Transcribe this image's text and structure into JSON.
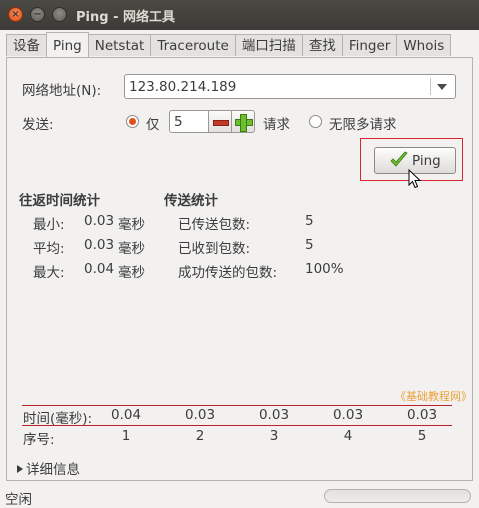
{
  "window": {
    "title": "Ping - 网络工具",
    "close_icon": "×",
    "minimize_icon": "−",
    "maximize_icon": ""
  },
  "tabs": [
    {
      "label": "设备",
      "active": false
    },
    {
      "label": "Ping",
      "active": true
    },
    {
      "label": "Netstat",
      "active": false
    },
    {
      "label": "Traceroute",
      "active": false
    },
    {
      "label": "端口扫描",
      "active": false
    },
    {
      "label": "查找",
      "active": false
    },
    {
      "label": "Finger",
      "active": false
    },
    {
      "label": "Whois",
      "active": false
    }
  ],
  "form": {
    "address_label": "网络地址(N):",
    "address_value": "123.80.214.189",
    "send_label": "发送:",
    "only_label": "仅",
    "count_value": "5",
    "requests_label": "请求",
    "unlimited_label": "无限多请求",
    "ping_button": "Ping"
  },
  "rtt": {
    "title": "往返时间统计",
    "rows": [
      {
        "label": "最小:",
        "value": "0.03",
        "unit": "毫秒"
      },
      {
        "label": "平均:",
        "value": "0.03",
        "unit": "毫秒"
      },
      {
        "label": "最大:",
        "value": "0.04",
        "unit": "毫秒"
      }
    ]
  },
  "transfer": {
    "title": "传送统计",
    "rows": [
      {
        "label": "已传送包数:",
        "value": "5"
      },
      {
        "label": "已收到包数:",
        "value": "5"
      },
      {
        "label": "成功传送的包数:",
        "value": "100%"
      }
    ]
  },
  "watermark": "《基础教程网》",
  "results": {
    "time_label": "时间(毫秒):",
    "seq_label": "序号:",
    "times": [
      "0.04",
      "0.03",
      "0.03",
      "0.03",
      "0.03"
    ],
    "seqs": [
      "1",
      "2",
      "3",
      "4",
      "5"
    ]
  },
  "details_label": "详细信息",
  "status_text": "空闲",
  "colors": {
    "accent": "#e0501f",
    "highlight_border": "#d9262e",
    "check": "#6cbf2f"
  }
}
